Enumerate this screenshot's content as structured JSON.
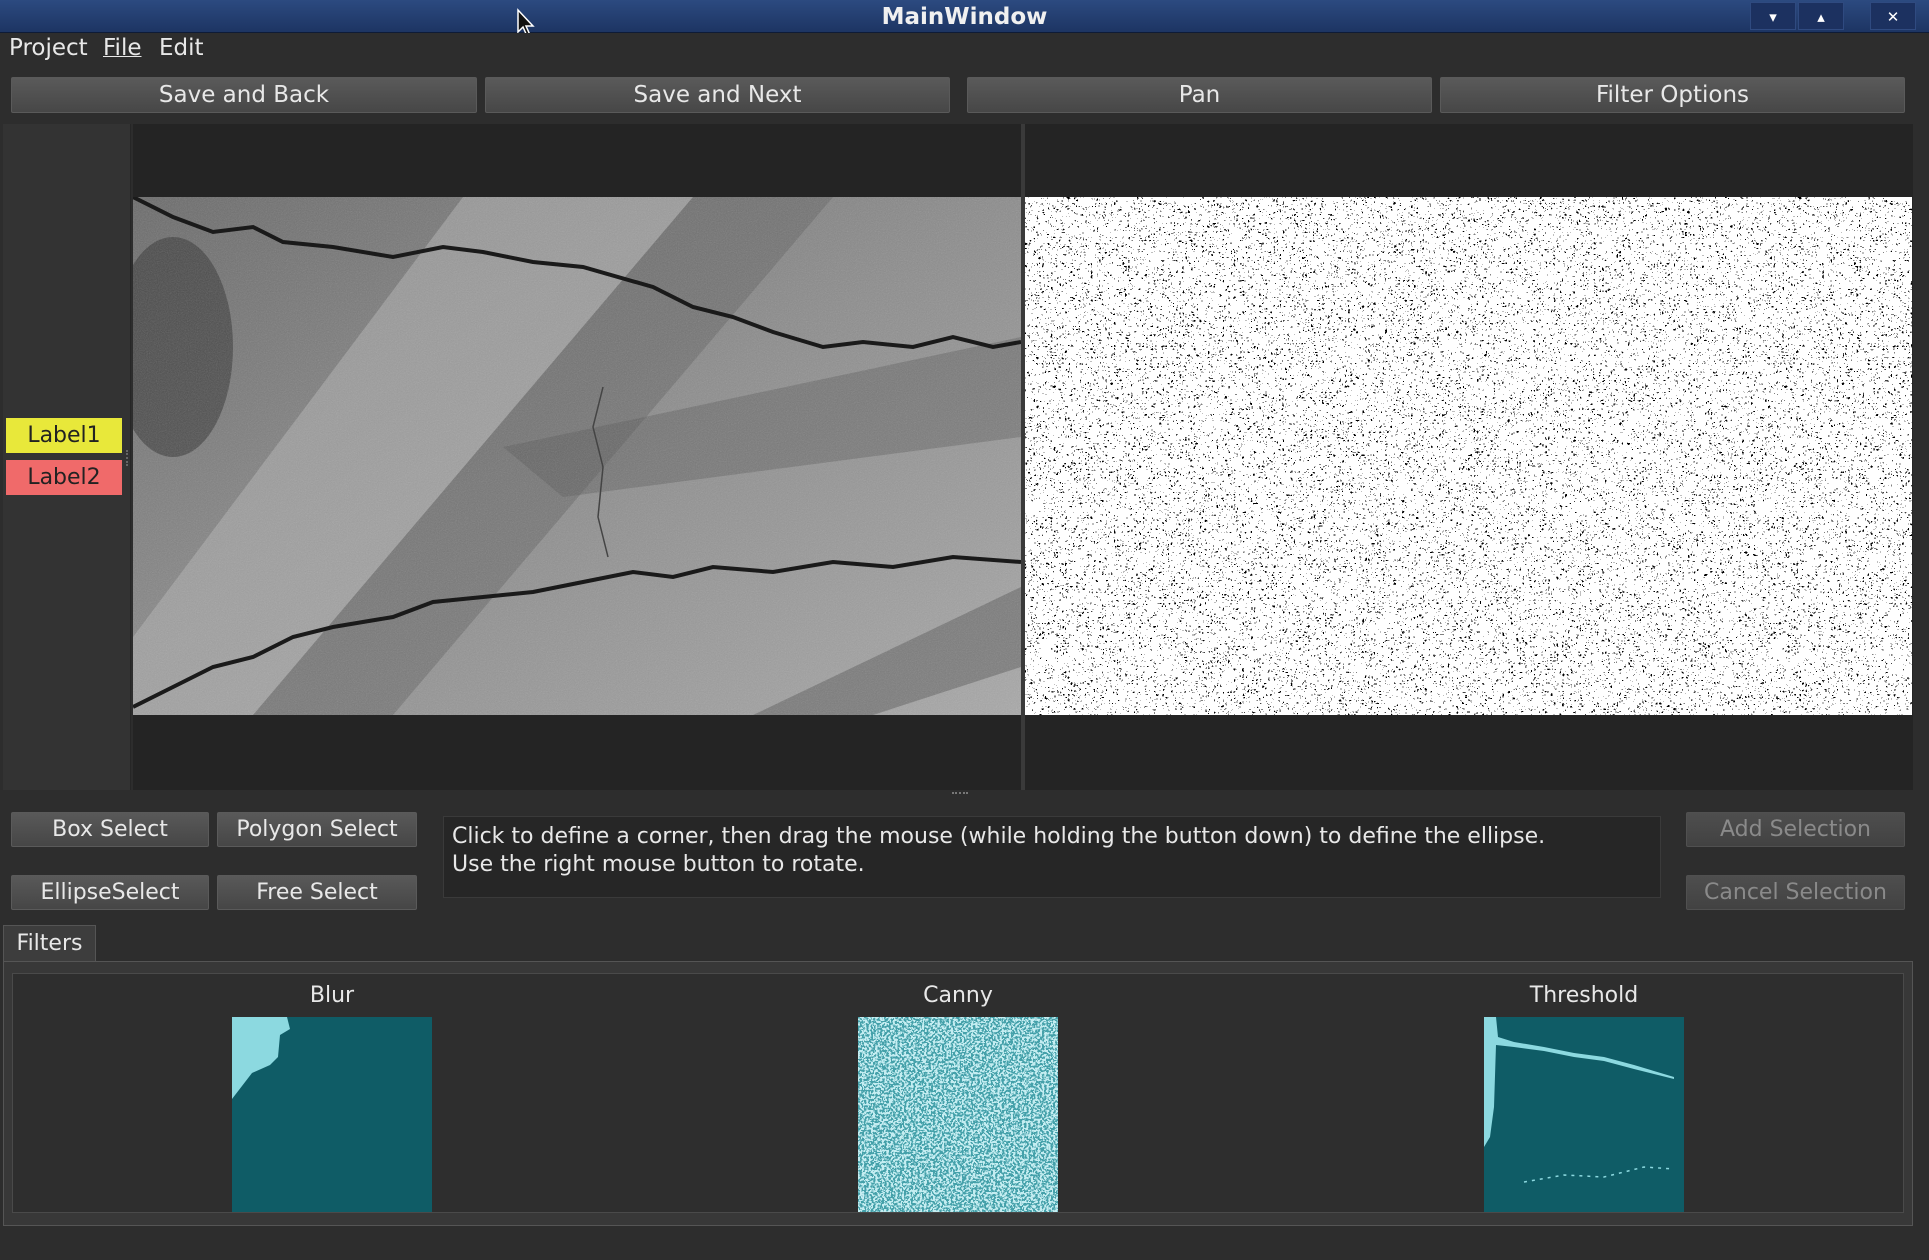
{
  "window": {
    "title": "MainWindow",
    "controls": [
      "▾",
      "▴",
      "✕"
    ]
  },
  "menu": {
    "items": [
      "Project",
      "File",
      "Edit"
    ]
  },
  "toolbar": {
    "save_back": "Save and Back",
    "save_next": "Save and Next",
    "pan": "Pan",
    "filter_options": "Filter Options"
  },
  "labels": [
    {
      "text": "Label1",
      "color": "#e8e83a"
    },
    {
      "text": "Label2",
      "color": "#f06a6a"
    }
  ],
  "tools": {
    "box_select": "Box Select",
    "polygon_select": "Polygon Select",
    "ellipse_select": "EllipseSelect",
    "free_select": "Free Select",
    "add_selection": "Add Selection",
    "cancel_selection": "Cancel Selection",
    "instructions_line1": "Click to define a corner, then drag the mouse (while holding the button down) to define the ellipse.",
    "instructions_line2": "Use the right mouse button to rotate."
  },
  "filters": {
    "tab_label": "Filters",
    "items": [
      {
        "name": "Blur"
      },
      {
        "name": "Canny"
      },
      {
        "name": "Threshold"
      }
    ],
    "thumb_color": "#0f5c66",
    "thumb_highlight": "#8cd9e0"
  }
}
